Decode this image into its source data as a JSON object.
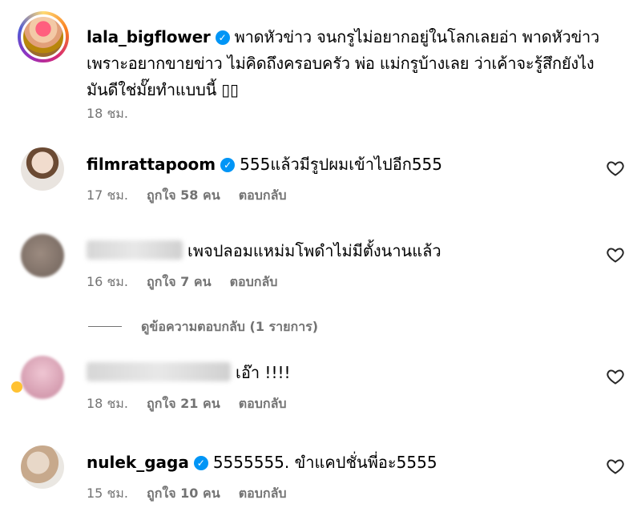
{
  "caption": {
    "username": "lala_bigflower",
    "text": "พาดหัวข่าว จนกรูไม่อยากอยู่ในโลกเลยอ่า พาดหัวข่าวเพราะอยากขายข่าว ไม่คิดถึงครอบครัว พ่อ แม่กรูบ้างเลย ว่าเค้าจะรู้สึกยังไง มันดีใช่มั๊ยทำแบบนี้",
    "time": "18 ชม."
  },
  "comments": [
    {
      "username": "filmrattapoom",
      "verified": true,
      "text": "555แล้วมีรูปผมเข้าไปอีก555",
      "time": "17 ชม.",
      "likes": "ถูกใจ 58 คน",
      "reply": "ตอบกลับ",
      "avatar_color": "#c9b8a8"
    },
    {
      "username": "",
      "verified": false,
      "text": "เพจปลอมแหม่มโพดำไม่มีตั้งนานแล้ว",
      "time": "16 ชม.",
      "likes": "ถูกใจ 7 คน",
      "reply": "ตอบกลับ",
      "avatar_color": "#8a7a70"
    },
    {
      "username": "",
      "verified": false,
      "text": "เอ๊า !!!!",
      "time": "18 ชม.",
      "likes": "ถูกใจ 21 คน",
      "reply": "ตอบกลับ",
      "avatar_color": "#d9a6b8"
    },
    {
      "username": "nulek_gaga",
      "verified": true,
      "text": "5555555. ขำแคปชั่นพี่อะ5555",
      "time": "15 ชม.",
      "likes": "ถูกใจ 10 คน",
      "reply": "ตอบกลับ",
      "avatar_color": "#d8c4b0"
    }
  ],
  "view_replies": "ดูข้อความตอบกลับ (1 รายการ)",
  "icons": {
    "verified": "verified-badge-icon",
    "like": "heart-outline-icon"
  },
  "colors": {
    "verified": "#0095f6",
    "secondary_text": "#737373"
  }
}
